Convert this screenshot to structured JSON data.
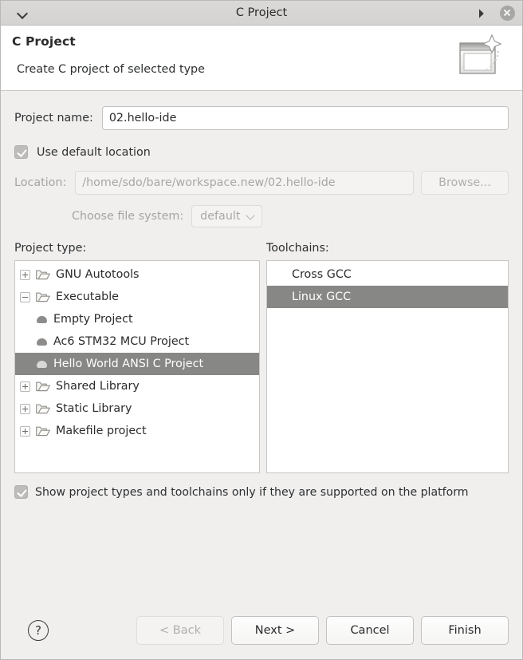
{
  "window": {
    "title": "C Project",
    "menu_icon": "chevron-down-icon",
    "restore_icon": "restore-icon",
    "close_icon": "close-icon"
  },
  "header": {
    "title": "C Project",
    "subtitle": "Create C project of selected type",
    "banner_icon": "new-project-wizard-icon"
  },
  "form": {
    "project_name_label": "Project name:",
    "project_name_value": "02.hello-ide",
    "use_default_location_label": "Use default location",
    "use_default_location_checked": true,
    "location_label": "Location:",
    "location_value": "/home/sdo/bare/workspace.new/02.hello-ide",
    "browse_label": "Browse...",
    "file_system_label": "Choose file system:",
    "file_system_value": "default"
  },
  "project_type": {
    "label": "Project type:",
    "items": [
      {
        "label": "GNU Autotools",
        "kind": "folder",
        "expander": "plus",
        "indent": 0,
        "selected": false
      },
      {
        "label": "Executable",
        "kind": "folder",
        "expander": "minus",
        "indent": 0,
        "selected": false
      },
      {
        "label": "Empty Project",
        "kind": "leaf",
        "expander": "none",
        "indent": 1,
        "selected": false
      },
      {
        "label": "Ac6 STM32 MCU Project",
        "kind": "leaf",
        "expander": "none",
        "indent": 1,
        "selected": false
      },
      {
        "label": "Hello World ANSI C Project",
        "kind": "leaf",
        "expander": "none",
        "indent": 1,
        "selected": true
      },
      {
        "label": "Shared Library",
        "kind": "folder",
        "expander": "plus",
        "indent": 0,
        "selected": false
      },
      {
        "label": "Static Library",
        "kind": "folder",
        "expander": "plus",
        "indent": 0,
        "selected": false
      },
      {
        "label": "Makefile project",
        "kind": "folder",
        "expander": "plus",
        "indent": 0,
        "selected": false
      }
    ]
  },
  "toolchains": {
    "label": "Toolchains:",
    "items": [
      {
        "label": "Cross GCC",
        "selected": false
      },
      {
        "label": "Linux GCC",
        "selected": true
      }
    ]
  },
  "options": {
    "show_supported_label": "Show project types and toolchains only if they are supported on the platform",
    "show_supported_checked": true
  },
  "footer": {
    "help_label": "?",
    "back_label": "< Back",
    "back_disabled": true,
    "next_label": "Next >",
    "cancel_label": "Cancel",
    "finish_label": "Finish"
  },
  "colors": {
    "titlebar": "#d6d5d3",
    "body": "#f0efee",
    "selection": "#878785",
    "panel": "#ffffff",
    "text": "#2b2b2b",
    "disabled_text": "#a8a7a5"
  }
}
